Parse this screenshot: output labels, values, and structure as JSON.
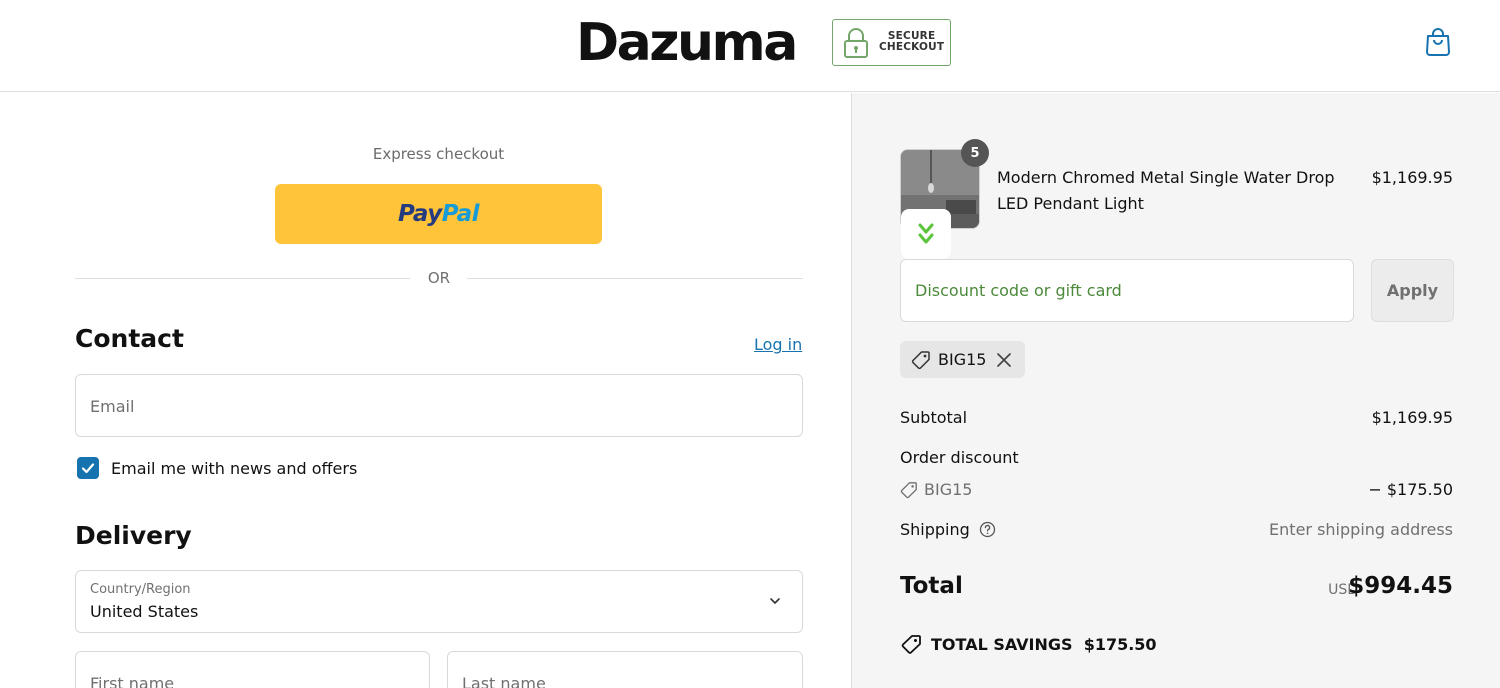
{
  "header": {
    "brand": "Dazuma",
    "badge_line1": "SECURE",
    "badge_line2": "CHECKOUT"
  },
  "checkout": {
    "express_label": "Express checkout",
    "paypal_part1": "Pay",
    "paypal_part2": "Pal",
    "divider_text": "OR",
    "contact": {
      "title": "Contact",
      "login_link": "Log in",
      "email_placeholder": "Email",
      "newsletter_label": "Email me with news and offers",
      "newsletter_checked": true
    },
    "delivery": {
      "title": "Delivery",
      "country_label": "Country/Region",
      "country_value": "United States",
      "first_name_placeholder": "First name",
      "last_name_placeholder": "Last name"
    }
  },
  "summary": {
    "product": {
      "name": "Modern Chromed Metal Single Water Drop LED Pendant Light",
      "price": "$1,169.95",
      "quantity": "5"
    },
    "discount": {
      "placeholder": "Discount code or gift card",
      "apply_label": "Apply",
      "applied_code": "BIG15"
    },
    "subtotal_label": "Subtotal",
    "subtotal_value": "$1,169.95",
    "order_discount_label": "Order discount",
    "order_discount_code": "BIG15",
    "order_discount_value": "− $175.50",
    "shipping_label": "Shipping",
    "shipping_value": "Enter shipping address",
    "total_label": "Total",
    "total_currency": "USD",
    "total_value": "$994.45",
    "savings_label": "TOTAL SAVINGS",
    "savings_value": "$175.50"
  },
  "colors": {
    "paypal_yellow": "#ffc439",
    "link_blue": "#1773b0",
    "badge_green": "#74a56a",
    "discount_green": "#4b8a3a"
  }
}
